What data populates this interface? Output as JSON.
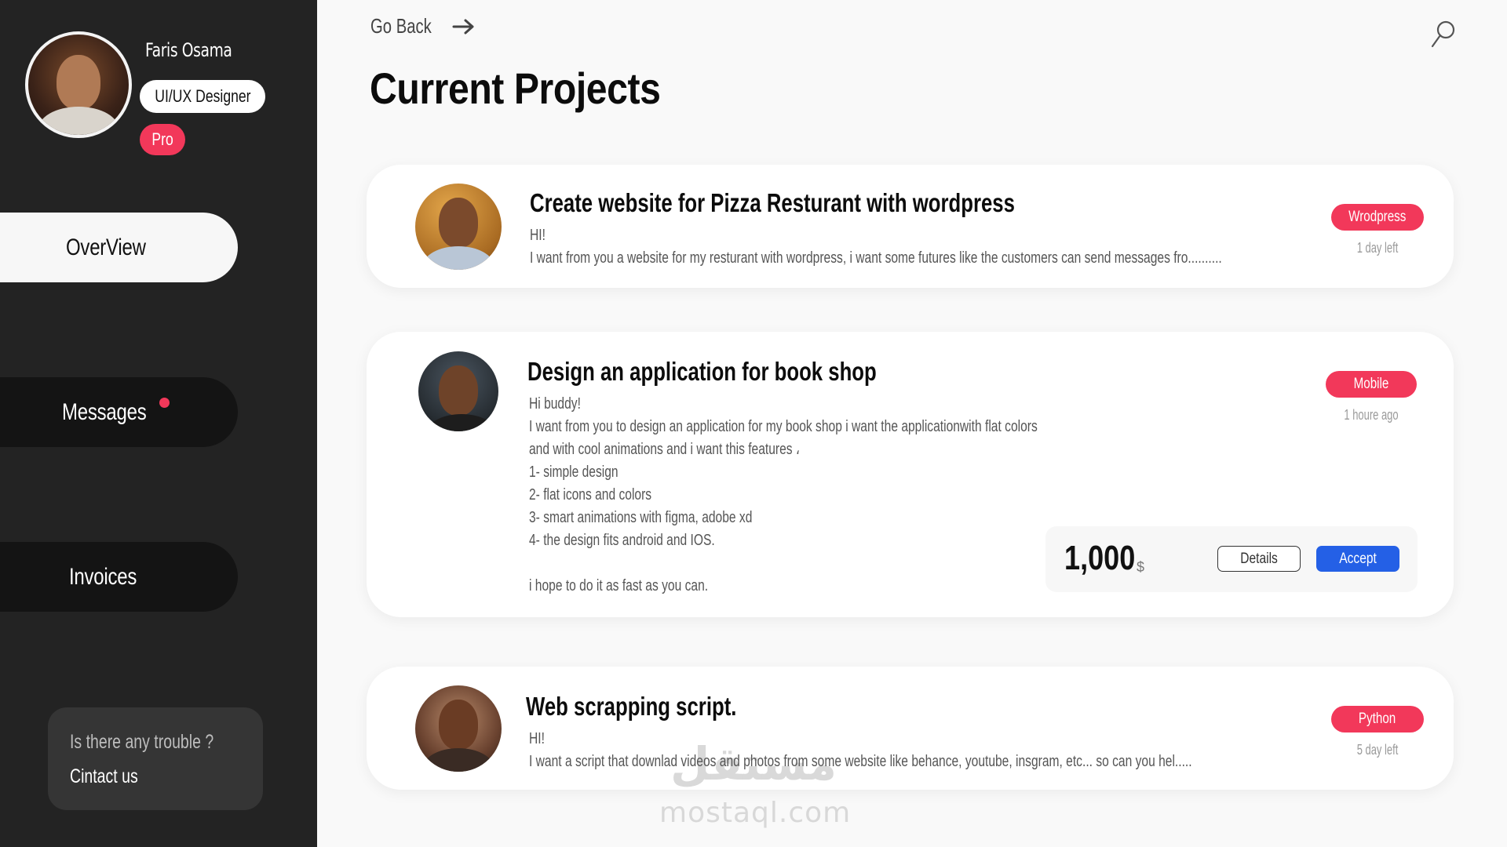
{
  "profile": {
    "name": "Faris Osama",
    "role": "UI/UX Designer",
    "badge": "Pro"
  },
  "nav": {
    "overview": "OverView",
    "messages": "Messages",
    "invoices": "Invoices"
  },
  "help": {
    "question": "Is there any trouble ?",
    "link": "Cintact us"
  },
  "header": {
    "go_back": "Go Back",
    "title": "Current Projects"
  },
  "projects": [
    {
      "title": "Create website for Pizza Resturant with wordpress",
      "body": [
        "HI!",
        "I want from you a website for my resturant with wordpress, i want some futures like the customers can send messages fro.........."
      ],
      "tag": "Wrodpress",
      "time": "1 day left"
    },
    {
      "title": "Design an application for book shop",
      "body": [
        "Hi buddy!",
        "I want from you to design an application for my book shop i want the applicationwith flat colors",
        "and with cool animations and i want this features ،",
        "1- simple design",
        "2- flat icons and colors",
        "3- smart animations with figma, adobe xd",
        "4- the design fits android and IOS.",
        "",
        "i hope to do it as fast as you can."
      ],
      "tag": "Mobile",
      "time": "1 houre ago",
      "price": "1,000",
      "currency": "$",
      "details_label": "Details",
      "accept_label": "Accept"
    },
    {
      "title": "Web scrapping script.",
      "body": [
        "HI!",
        "I want a script that downlad videos and photos from some website like behance, youtube, insgram, etc... so can you hel....."
      ],
      "tag": "Python",
      "time": "5 day left"
    }
  ],
  "watermark": {
    "arabic": "مستقل",
    "latin": "mostaql.com"
  },
  "colors": {
    "sidebar": "#232323",
    "accent_pink": "#f2385a",
    "accept_blue": "#2460e6",
    "page_bg": "#f9f9f9"
  },
  "icons": [
    "arrow-right-icon",
    "search-icon",
    "notification-dot-icon"
  ]
}
